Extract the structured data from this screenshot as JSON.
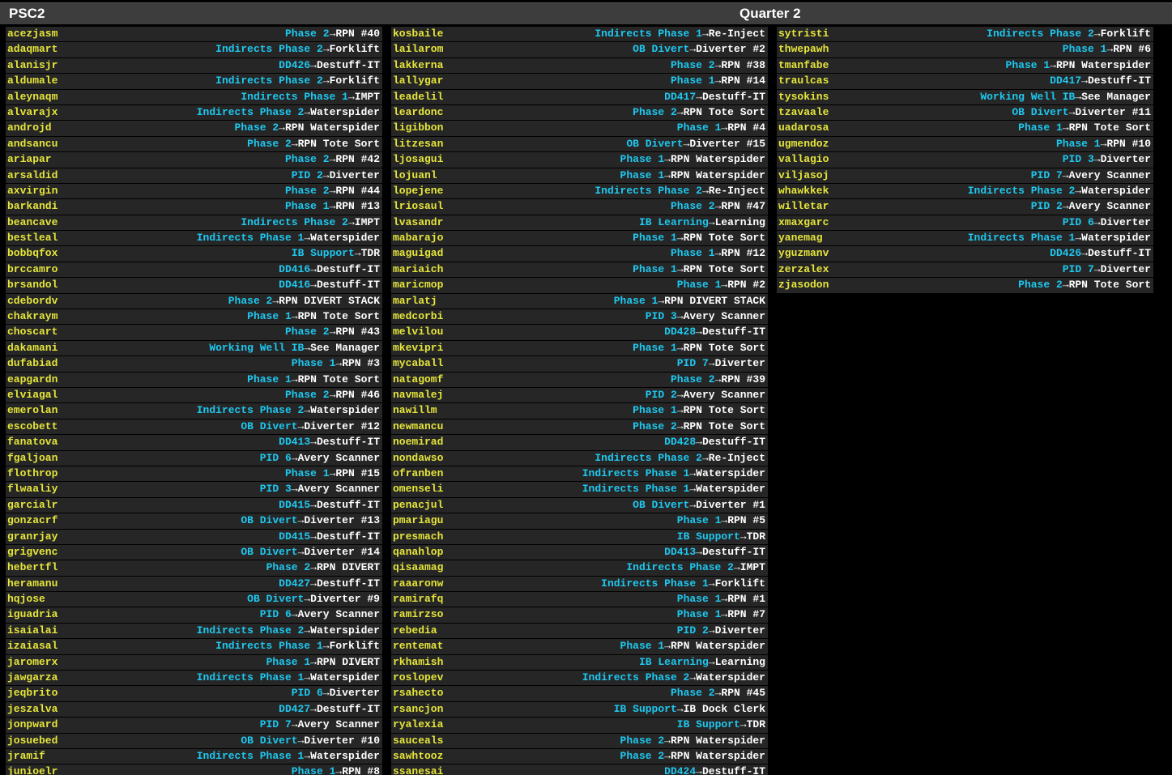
{
  "header": {
    "title": "PSC2",
    "shift": "Quarter 2"
  },
  "columns": [
    [
      {
        "user": "acezjasm",
        "area": "Phase 2",
        "task": "RPN #40"
      },
      {
        "user": "adaqmart",
        "area": "Indirects Phase 2",
        "task": "Forklift"
      },
      {
        "user": "alanisjr",
        "area": "DD426",
        "task": "Destuff-IT"
      },
      {
        "user": "aldumale",
        "area": "Indirects Phase 2",
        "task": "Forklift"
      },
      {
        "user": "aleynaqm",
        "area": "Indirects Phase 1",
        "task": "IMPT"
      },
      {
        "user": "alvarajx",
        "area": "Indirects Phase 2",
        "task": "Waterspider"
      },
      {
        "user": "androjd",
        "area": "Phase 2",
        "task": "RPN Waterspider"
      },
      {
        "user": "andsancu",
        "area": "Phase 2",
        "task": "RPN Tote Sort"
      },
      {
        "user": "ariapar",
        "area": "Phase 2",
        "task": "RPN #42"
      },
      {
        "user": "arsaldid",
        "area": "PID 2",
        "task": "Diverter"
      },
      {
        "user": "axvirgin",
        "area": "Phase 2",
        "task": "RPN #44"
      },
      {
        "user": "barkandi",
        "area": "Phase 1",
        "task": "RPN #13"
      },
      {
        "user": "beancave",
        "area": "Indirects Phase 2",
        "task": "IMPT"
      },
      {
        "user": "bestleal",
        "area": "Indirects Phase 1",
        "task": "Waterspider"
      },
      {
        "user": "bobbqfox",
        "area": "IB Support",
        "task": "TDR"
      },
      {
        "user": "brccamro",
        "area": "DD416",
        "task": "Destuff-IT"
      },
      {
        "user": "brsandol",
        "area": "DD416",
        "task": "Destuff-IT"
      },
      {
        "user": "cdebordv",
        "area": "Phase 2",
        "task": "RPN DIVERT STACK"
      },
      {
        "user": "chakraym",
        "area": "Phase 1",
        "task": "RPN Tote Sort"
      },
      {
        "user": "choscart",
        "area": "Phase 2",
        "task": "RPN #43"
      },
      {
        "user": "dakamani",
        "area": "Working Well IB",
        "task": "See Manager"
      },
      {
        "user": "dufabiad",
        "area": "Phase 1",
        "task": "RPN #3"
      },
      {
        "user": "eapgardn",
        "area": "Phase 1",
        "task": "RPN Tote Sort"
      },
      {
        "user": "elviagal",
        "area": "Phase 2",
        "task": "RPN #46"
      },
      {
        "user": "emerolan",
        "area": "Indirects Phase 2",
        "task": "Waterspider"
      },
      {
        "user": "escobett",
        "area": "OB Divert",
        "task": "Diverter #12"
      },
      {
        "user": "fanatova",
        "area": "DD413",
        "task": "Destuff-IT"
      },
      {
        "user": "fgaljoan",
        "area": "PID 6",
        "task": "Avery Scanner"
      },
      {
        "user": "flothrop",
        "area": "Phase 1",
        "task": "RPN #15"
      },
      {
        "user": "flwaaliy",
        "area": "PID 3",
        "task": "Avery Scanner"
      },
      {
        "user": "garcialr",
        "area": "DD415",
        "task": "Destuff-IT"
      },
      {
        "user": "gonzacrf",
        "area": "OB Divert",
        "task": "Diverter #13"
      },
      {
        "user": "granrjay",
        "area": "DD415",
        "task": "Destuff-IT"
      },
      {
        "user": "grigvenc",
        "area": "OB Divert",
        "task": "Diverter #14"
      },
      {
        "user": "hebertfl",
        "area": "Phase 2",
        "task": "RPN DIVERT"
      },
      {
        "user": "heramanu",
        "area": "DD427",
        "task": "Destuff-IT"
      },
      {
        "user": "hqjose",
        "area": "OB Divert",
        "task": "Diverter #9"
      },
      {
        "user": "iguadria",
        "area": "PID 6",
        "task": "Avery Scanner"
      },
      {
        "user": "isaialai",
        "area": "Indirects Phase 2",
        "task": "Waterspider"
      },
      {
        "user": "izaiasal",
        "area": "Indirects Phase 1",
        "task": "Forklift"
      },
      {
        "user": "jaromerx",
        "area": "Phase 1",
        "task": "RPN DIVERT"
      },
      {
        "user": "jawgarza",
        "area": "Indirects Phase 1",
        "task": "Waterspider"
      },
      {
        "user": "jeqbrito",
        "area": "PID 6",
        "task": "Diverter"
      },
      {
        "user": "jeszalva",
        "area": "DD427",
        "task": "Destuff-IT"
      },
      {
        "user": "jonpward",
        "area": "PID 7",
        "task": "Avery Scanner"
      },
      {
        "user": "josuebed",
        "area": "OB Divert",
        "task": "Diverter #10"
      },
      {
        "user": "jramif",
        "area": "Indirects Phase 1",
        "task": "Waterspider"
      },
      {
        "user": "junioelr",
        "area": "Phase 1",
        "task": "RPN #8"
      }
    ],
    [
      {
        "user": "kosbaile",
        "area": "Indirects Phase 1",
        "task": "Re-Inject"
      },
      {
        "user": "lailarom",
        "area": "OB Divert",
        "task": "Diverter #2"
      },
      {
        "user": "lakkerna",
        "area": "Phase 2",
        "task": "RPN #38"
      },
      {
        "user": "lallygar",
        "area": "Phase 1",
        "task": "RPN #14"
      },
      {
        "user": "leadelil",
        "area": "DD417",
        "task": "Destuff-IT"
      },
      {
        "user": "leardonc",
        "area": "Phase 2",
        "task": "RPN Tote Sort"
      },
      {
        "user": "ligibbon",
        "area": "Phase 1",
        "task": "RPN #4"
      },
      {
        "user": "litzesan",
        "area": "OB Divert",
        "task": "Diverter #15"
      },
      {
        "user": "ljosagui",
        "area": "Phase 1",
        "task": "RPN Waterspider"
      },
      {
        "user": "lojuanl",
        "area": "Phase 1",
        "task": "RPN Waterspider"
      },
      {
        "user": "lopejene",
        "area": "Indirects Phase 2",
        "task": "Re-Inject"
      },
      {
        "user": "lriosaul",
        "area": "Phase 2",
        "task": "RPN #47"
      },
      {
        "user": "lvasandr",
        "area": "IB Learning",
        "task": "Learning"
      },
      {
        "user": "mabarajo",
        "area": "Phase 1",
        "task": "RPN Tote Sort"
      },
      {
        "user": "maguigad",
        "area": "Phase 1",
        "task": "RPN #12"
      },
      {
        "user": "mariaich",
        "area": "Phase 1",
        "task": "RPN Tote Sort"
      },
      {
        "user": "maricmop",
        "area": "Phase 1",
        "task": "RPN #2"
      },
      {
        "user": "marlatj",
        "area": "Phase 1",
        "task": "RPN DIVERT STACK"
      },
      {
        "user": "medcorbi",
        "area": "PID 3",
        "task": "Avery Scanner"
      },
      {
        "user": "melvilou",
        "area": "DD428",
        "task": "Destuff-IT"
      },
      {
        "user": "mkevipri",
        "area": "Phase 1",
        "task": "RPN Tote Sort"
      },
      {
        "user": "mycaball",
        "area": "PID 7",
        "task": "Diverter"
      },
      {
        "user": "natagomf",
        "area": "Phase 2",
        "task": "RPN #39"
      },
      {
        "user": "navmalej",
        "area": "PID 2",
        "task": "Avery Scanner"
      },
      {
        "user": "nawillm",
        "area": "Phase 1",
        "task": "RPN Tote Sort"
      },
      {
        "user": "newmancu",
        "area": "Phase 2",
        "task": "RPN Tote Sort"
      },
      {
        "user": "noemirad",
        "area": "DD428",
        "task": "Destuff-IT"
      },
      {
        "user": "nondawso",
        "area": "Indirects Phase 2",
        "task": "Re-Inject"
      },
      {
        "user": "ofranben",
        "area": "Indirects Phase 1",
        "task": "Waterspider"
      },
      {
        "user": "omenseli",
        "area": "Indirects Phase 1",
        "task": "Waterspider"
      },
      {
        "user": "penacjul",
        "area": "OB Divert",
        "task": "Diverter #1"
      },
      {
        "user": "pmariagu",
        "area": "Phase 1",
        "task": "RPN #5"
      },
      {
        "user": "presmach",
        "area": "IB Support",
        "task": "TDR"
      },
      {
        "user": "qanahlop",
        "area": "DD413",
        "task": "Destuff-IT"
      },
      {
        "user": "qisaamag",
        "area": "Indirects Phase 2",
        "task": "IMPT"
      },
      {
        "user": "raaaronw",
        "area": "Indirects Phase 1",
        "task": "Forklift"
      },
      {
        "user": "ramirafq",
        "area": "Phase 1",
        "task": "RPN #1"
      },
      {
        "user": "ramirzso",
        "area": "Phase 1",
        "task": "RPN #7"
      },
      {
        "user": "rebedia",
        "area": "PID 2",
        "task": "Diverter"
      },
      {
        "user": "rentemat",
        "area": "Phase 1",
        "task": "RPN Waterspider"
      },
      {
        "user": "rkhamish",
        "area": "IB Learning",
        "task": "Learning"
      },
      {
        "user": "roslopev",
        "area": "Indirects Phase 2",
        "task": "Waterspider"
      },
      {
        "user": "rsahecto",
        "area": "Phase 2",
        "task": "RPN #45"
      },
      {
        "user": "rsancjon",
        "area": "IB Support",
        "task": "IB Dock Clerk"
      },
      {
        "user": "ryalexia",
        "area": "IB Support",
        "task": "TDR"
      },
      {
        "user": "sauceals",
        "area": "Phase 2",
        "task": "RPN Waterspider"
      },
      {
        "user": "sawhtooz",
        "area": "Phase 2",
        "task": "RPN Waterspider"
      },
      {
        "user": "ssanesai",
        "area": "DD424",
        "task": "Destuff-IT"
      }
    ],
    [
      {
        "user": "sytristi",
        "area": "Indirects Phase 2",
        "task": "Forklift"
      },
      {
        "user": "thwepawh",
        "area": "Phase 1",
        "task": "RPN #6"
      },
      {
        "user": "tmanfabe",
        "area": "Phase 1",
        "task": "RPN Waterspider"
      },
      {
        "user": "traulcas",
        "area": "DD417",
        "task": "Destuff-IT"
      },
      {
        "user": "tysokins",
        "area": "Working Well IB",
        "task": "See Manager"
      },
      {
        "user": "tzavaale",
        "area": "OB Divert",
        "task": "Diverter #11"
      },
      {
        "user": "uadarosa",
        "area": "Phase 1",
        "task": "RPN Tote Sort"
      },
      {
        "user": "ugmendoz",
        "area": "Phase 1",
        "task": "RPN #10"
      },
      {
        "user": "vallagio",
        "area": "PID 3",
        "task": "Diverter"
      },
      {
        "user": "viljasoj",
        "area": "PID 7",
        "task": "Avery Scanner"
      },
      {
        "user": "whawkkek",
        "area": "Indirects Phase 2",
        "task": "Waterspider"
      },
      {
        "user": "willetar",
        "area": "PID 2",
        "task": "Avery Scanner"
      },
      {
        "user": "xmaxgarc",
        "area": "PID 6",
        "task": "Diverter"
      },
      {
        "user": "yanemag",
        "area": "Indirects Phase 1",
        "task": "Waterspider"
      },
      {
        "user": "yguzmanv",
        "area": "DD426",
        "task": "Destuff-IT"
      },
      {
        "user": "zerzalex",
        "area": "PID 7",
        "task": "Diverter"
      },
      {
        "user": "zjasodon",
        "area": "Phase 2",
        "task": "RPN Tote Sort"
      }
    ]
  ],
  "arrow": "→",
  "colors": {
    "background": "#000000",
    "row_bg": "#262626",
    "header_bg": "#3d3d3d",
    "username": "#e6e63c",
    "area": "#1ec8f0",
    "task": "#ffffff"
  }
}
